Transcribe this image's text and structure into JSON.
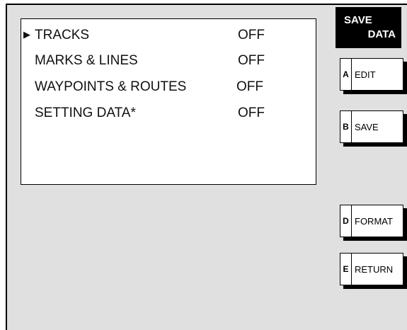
{
  "menu": {
    "title_line1": "SAVE",
    "title_line2": "DATA",
    "cursor": "▶",
    "items": [
      {
        "label": "TRACKS",
        "value": "OFF"
      },
      {
        "label": "MARKS & LINES",
        "value": "OFF"
      },
      {
        "label": "WAYPOINTS & ROUTES",
        "value": "OFF"
      },
      {
        "label": "SETTING DATA*",
        "value": "OFF"
      }
    ]
  },
  "softkeys": [
    {
      "key": "A",
      "label": "EDIT"
    },
    {
      "key": "B",
      "label": "SAVE"
    },
    {
      "key": "D",
      "label": "FORMAT"
    },
    {
      "key": "E",
      "label": "RETURN"
    }
  ]
}
